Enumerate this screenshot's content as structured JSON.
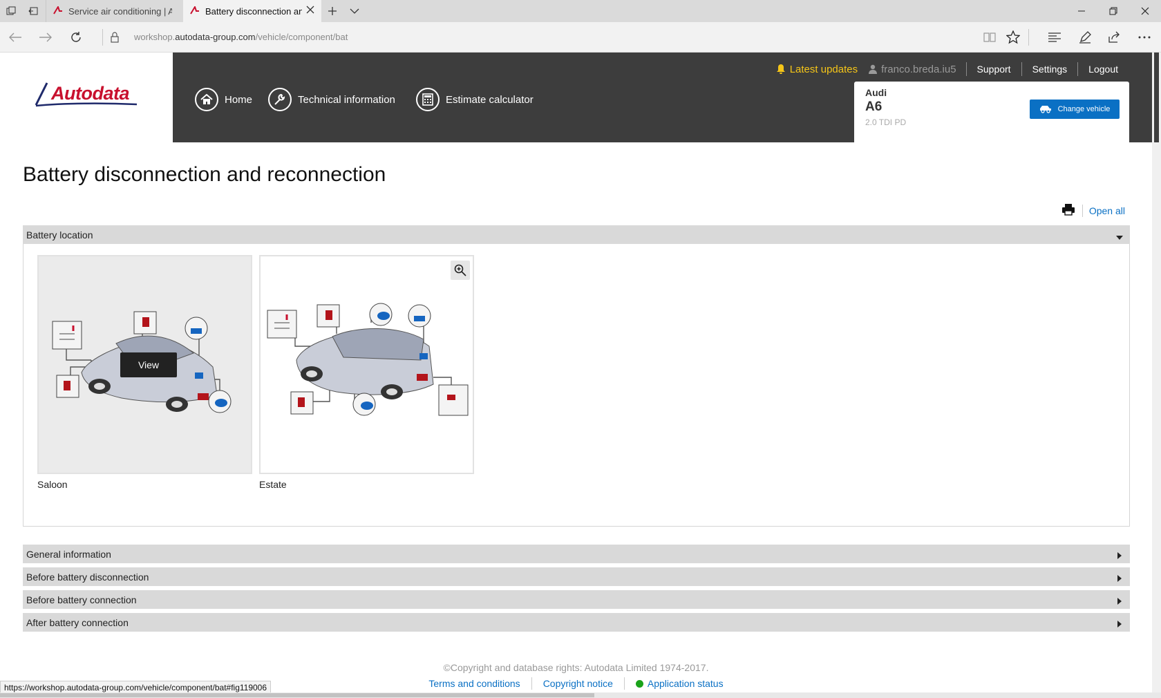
{
  "browser": {
    "tabs": [
      {
        "title": "Service air conditioning | Autodata",
        "active": false
      },
      {
        "title": "Battery disconnection and reconnection",
        "active": true
      }
    ],
    "url_prefix": "workshop.",
    "url_domain": "autodata-group.com",
    "url_path": "/vehicle/component/bat",
    "status_url": "https://workshop.autodata-group.com/vehicle/component/bat#fig119006"
  },
  "site": {
    "logo_text": "Autodata",
    "nav": [
      {
        "label": "Home",
        "icon": "home-icon"
      },
      {
        "label": "Technical information",
        "icon": "wrench-icon"
      },
      {
        "label": "Estimate calculator",
        "icon": "calculator-icon"
      }
    ],
    "latest_updates": "Latest updates",
    "username": "franco.breda.iu5",
    "links": {
      "support": "Support",
      "settings": "Settings",
      "logout": "Logout"
    },
    "vehicle": {
      "make": "Audi",
      "model": "A6",
      "engine": "2.0 TDI PD",
      "change_label": "Change vehicle"
    }
  },
  "page": {
    "title": "Battery disconnection and reconnection",
    "open_all": "Open all",
    "sections": [
      {
        "title": "Battery location",
        "expanded": true
      },
      {
        "title": "General information",
        "expanded": false
      },
      {
        "title": "Before battery disconnection",
        "expanded": false
      },
      {
        "title": "Before battery connection",
        "expanded": false
      },
      {
        "title": "After battery connection",
        "expanded": false
      }
    ],
    "figures": [
      {
        "caption": "Saloon",
        "hover_label": "View"
      },
      {
        "caption": "Estate"
      }
    ]
  },
  "footer": {
    "copyright": "©Copyright and database rights: Autodata Limited 1974-2017.",
    "links": [
      "Terms and conditions",
      "Copyright notice",
      "Application status"
    ]
  },
  "colors": {
    "brand_red": "#c8102e",
    "accent_blue": "#0a70c4",
    "header_dark": "#3d3d3d",
    "updates_yellow": "#f5c518"
  }
}
